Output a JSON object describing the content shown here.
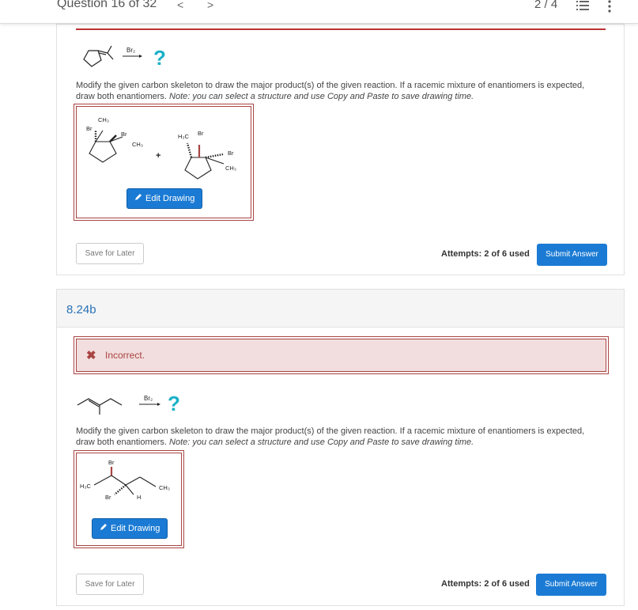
{
  "topbar": {
    "question_label": "Question 16 of 32",
    "prev": "<",
    "next": ">",
    "page_count": "2 / 4"
  },
  "q1": {
    "reagent": "Br₂",
    "question_mark": "?",
    "description": "Modify the given carbon skeleton to draw the major product(s) of the given reaction. If a racemic mixture of enantiomers is expected, draw both enantiomers.",
    "note": "Note: you can select a structure and use Copy and Paste to save drawing time.",
    "drawing_labels": {
      "br": "Br",
      "ch3": "CH₃",
      "h3c": "H₃C",
      "plus": "+"
    },
    "edit_label": "Edit Drawing",
    "save_label": "Save for Later",
    "attempts": "Attempts: 2 of 6 used",
    "submit_label": "Submit Answer"
  },
  "q2": {
    "number": "8.24b",
    "incorrect_label": "Incorrect.",
    "reagent": "Br₂",
    "question_mark": "?",
    "description": "Modify the given carbon skeleton to draw the major product(s) of the given reaction. If a racemic mixture of enantiomers is expected, draw both enantiomers.",
    "note": "Note: you can select a structure and use Copy and Paste to save drawing time.",
    "drawing_labels": {
      "br": "Br",
      "h3c": "H₃C",
      "ch3": "CH₃",
      "h": "H"
    },
    "edit_label": "Edit Drawing",
    "save_label": "Save for Later",
    "attempts": "Attempts: 2 of 6 used",
    "submit_label": "Submit Answer"
  },
  "colors": {
    "accent": "#1b7bd4",
    "error": "#a94442",
    "error_bg": "#f2dede",
    "question_mark": "#1ab0c8",
    "link": "#2a72b5"
  }
}
